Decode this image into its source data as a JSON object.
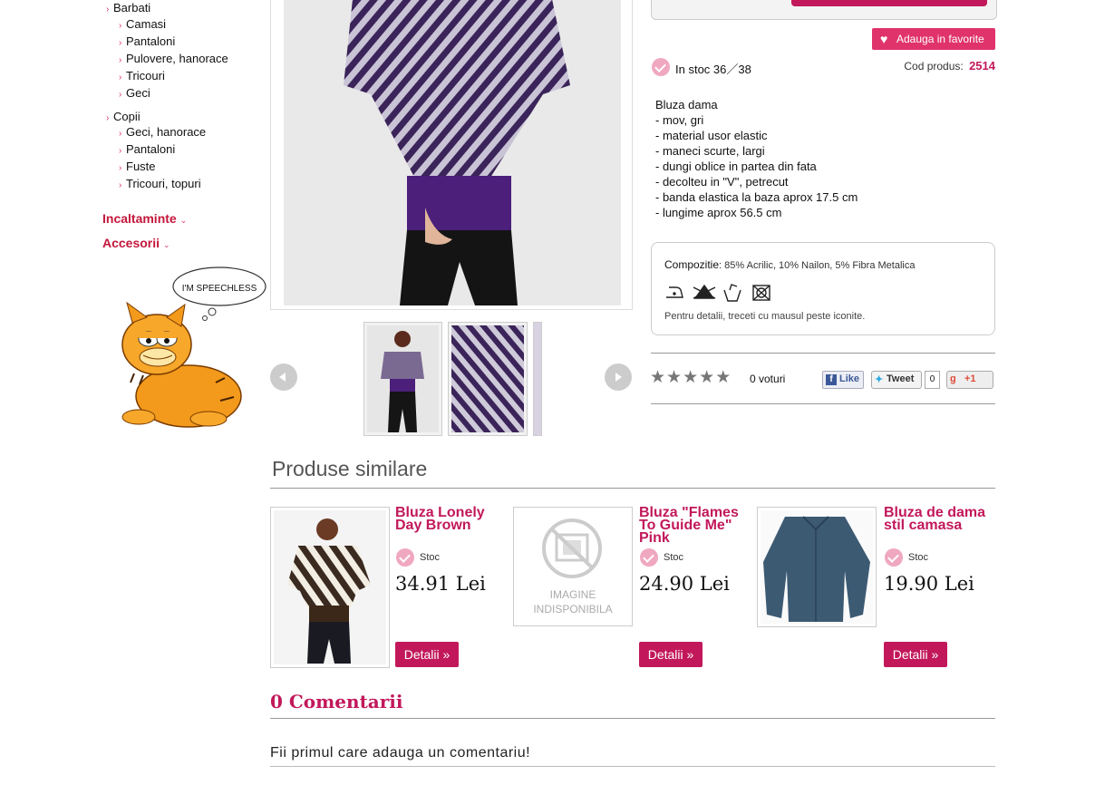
{
  "sidebar": {
    "barbati": {
      "label": "Barbati",
      "items": [
        "Camasi",
        "Pantaloni",
        "Pulovere, hanorace",
        "Tricouri",
        "Geci"
      ]
    },
    "copii": {
      "label": "Copii",
      "items": [
        "Geci, hanorace",
        "Pantaloni",
        "Fuste",
        "Tricouri, topuri"
      ]
    },
    "incaltaminte": "Incaltaminte",
    "accesorii": "Accesorii",
    "bubble_text": "I'M SPEECHLESS"
  },
  "product": {
    "favorite_label": "Adauga in favorite",
    "stock_label": "In stoc 36／38",
    "code_label": "Cod produs:",
    "code_value": "2514",
    "description": [
      "Bluza dama",
      "- mov, gri",
      "- material usor elastic",
      "- maneci scurte, largi",
      "- dungi oblice in partea din fata",
      "- decolteu in \"V\", petrecut",
      "- banda elastica la baza aprox 17.5 cm",
      "- lungime aprox 56.5 cm"
    ],
    "composition_label": "Compozitie",
    "composition_value": ": 85% Acrilic, 10% Nailon, 5% Fibra Metalica",
    "care_hint": "Pentru detalii, treceti cu mausul peste iconite.",
    "rating": 0,
    "votes_label": "0 voturi",
    "fb_like": "Like",
    "tweet": "Tweet",
    "tweet_count": "0",
    "gplus": "+1"
  },
  "similar": {
    "title": "Produse similare",
    "items": [
      {
        "name": "Bluza Lonely Day Brown",
        "stock": "Stoc",
        "price": "34.91 Lei",
        "button": "Detalii »"
      },
      {
        "name": "Bluza \"Flames To Guide Me\" Pink",
        "stock": "Stoc",
        "price": "24.90 Lei",
        "button": "Detalii »",
        "placeholder": "IMAGINE INDISPONIBILA"
      },
      {
        "name": "Bluza de dama stil camasa",
        "stock": "Stoc",
        "price": "19.90 Lei",
        "button": "Detalii »"
      }
    ]
  },
  "comments": {
    "title": "0 Comentarii",
    "first_prompt": "Fii primul care adauga un comentariu!"
  },
  "colors": {
    "accent": "#c2185b",
    "section_red": "#c4163b",
    "check_pink": "#f0a7c0"
  }
}
